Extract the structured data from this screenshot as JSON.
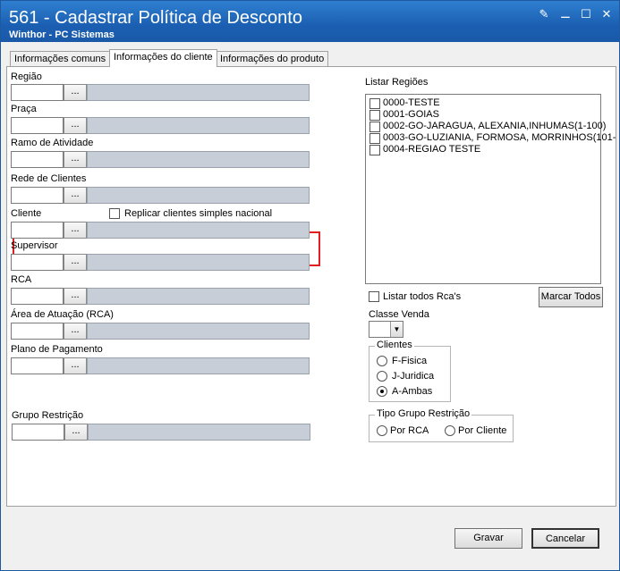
{
  "window": {
    "title": "561 - Cadastrar Política de Desconto",
    "subtitle": "Winthor - PC Sistemas"
  },
  "tabs": [
    {
      "label": "Informações comuns"
    },
    {
      "label": "Informações do cliente"
    },
    {
      "label": "Informações do produto"
    }
  ],
  "fields": {
    "regiao": "Região",
    "praca": "Praça",
    "ramo": "Ramo de Atividade",
    "rede": "Rede de Clientes",
    "cliente": "Cliente",
    "replicar": "Replicar clientes simples nacional",
    "supervisor": "Supervisor",
    "rca": "RCA",
    "area": "Área de Atuação (RCA)",
    "plano": "Plano de Pagamento",
    "grupo": "Grupo Restrição"
  },
  "lookup_button_label": "...",
  "regions": {
    "label": "Listar Regiões",
    "items": [
      "0000-TESTE",
      "0001-GOIAS",
      "0002-GO-JARAGUA, ALEXANIA,INHUMAS(1-100)",
      "0003-GO-LUZIANIA, FORMOSA, MORRINHOS(101-",
      "0004-REGIAO TESTE"
    ]
  },
  "listar_rcas": "Listar todos Rca's",
  "marcar_todos": "Marcar Todos",
  "classe_venda": "Classe Venda",
  "clientes_group": {
    "title": "Clientes",
    "options": [
      "F-Fisica",
      "J-Juridica",
      "A-Ambas"
    ],
    "selected": "A-Ambas"
  },
  "tipo_grupo": {
    "title": "Tipo Grupo Restrição",
    "options": [
      "Por RCA",
      "Por Cliente"
    ]
  },
  "buttons": {
    "gravar": "Gravar",
    "cancelar": "Cancelar"
  },
  "colors": {
    "titlebar": "#1b5fb2",
    "highlight": "#e02020",
    "readonly_field": "#c7ced7"
  }
}
